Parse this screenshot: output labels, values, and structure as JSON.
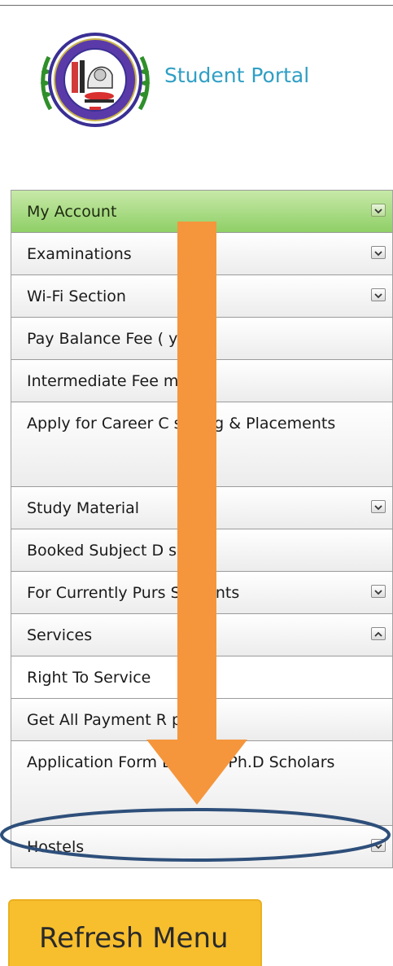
{
  "header": {
    "title": "Student Portal"
  },
  "menu": {
    "items": [
      {
        "label": "My Account",
        "has_chevron": true,
        "chevron": "down",
        "state": "active"
      },
      {
        "label": "Examinations",
        "has_chevron": true,
        "chevron": "down",
        "state": "normal"
      },
      {
        "label": "Wi-Fi Section",
        "has_chevron": true,
        "chevron": "down",
        "state": "normal"
      },
      {
        "label": "Pay Balance Fee (        y)",
        "has_chevron": false,
        "state": "normal"
      },
      {
        "label": "Intermediate Fee        ment",
        "has_chevron": false,
        "state": "normal"
      },
      {
        "label": "Apply for Career C        selling & Placements",
        "has_chevron": false,
        "state": "normal"
      },
      {
        "label": "Study Material",
        "has_chevron": true,
        "chevron": "down",
        "state": "normal"
      },
      {
        "label": "Booked Subject D        s",
        "has_chevron": false,
        "state": "normal"
      },
      {
        "label": "For Currently Purs        Students",
        "has_chevron": true,
        "chevron": "down",
        "state": "normal"
      },
      {
        "label": "Services",
        "has_chevron": true,
        "chevron": "up",
        "state": "normal"
      },
      {
        "label": "Right To Service",
        "has_chevron": false,
        "state": "plain"
      },
      {
        "label": "Get All Payment R        pts",
        "has_chevron": false,
        "state": "normal"
      },
      {
        "label": "Application Form        Existing Ph.D Scholars",
        "has_chevron": false,
        "state": "normal"
      },
      {
        "label": "Hostels",
        "has_chevron": true,
        "chevron": "down",
        "state": "normal"
      }
    ]
  },
  "refresh_button": {
    "label": "Refresh Menu"
  },
  "colors": {
    "active_item": "#8fcf66",
    "title_text": "#2f9fc4",
    "refresh_button": "#f7bf2e",
    "annotation_arrow": "#f5963c",
    "annotation_ellipse": "#2e4f7a"
  },
  "icons": {
    "logo": "university-seal-logo",
    "chevron_down": "chevron-down-icon",
    "chevron_up": "chevron-up-icon",
    "annotation_arrow": "down-arrow-annotation",
    "annotation_ellipse": "ellipse-highlight-annotation"
  }
}
